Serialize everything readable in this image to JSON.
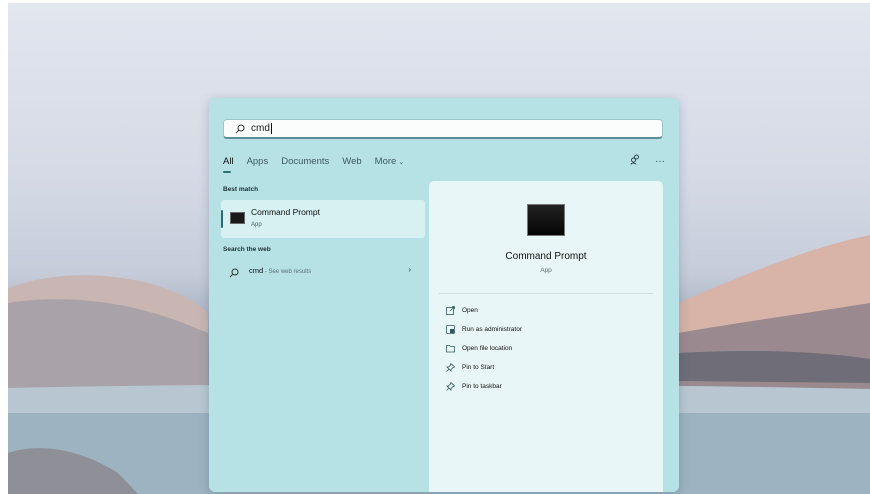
{
  "search": {
    "query": "cmd"
  },
  "tabs": [
    {
      "label": "All"
    },
    {
      "label": "Apps"
    },
    {
      "label": "Documents"
    },
    {
      "label": "Web"
    },
    {
      "label": "More"
    }
  ],
  "header_icons": [
    "people-switch-icon",
    "more-options-icon"
  ],
  "best_match": {
    "section_label": "Best match",
    "title": "Command Prompt",
    "subtitle": "App"
  },
  "web": {
    "section_label": "Search the web",
    "query": "cmd",
    "suffix": " - See web results"
  },
  "detail": {
    "title": "Command Prompt",
    "subtitle": "App",
    "actions": [
      {
        "label": "Open",
        "icon": "open-icon"
      },
      {
        "label": "Run as administrator",
        "icon": "shield-admin-icon"
      },
      {
        "label": "Open file location",
        "icon": "folder-icon"
      },
      {
        "label": "Pin to Start",
        "icon": "pin-icon"
      },
      {
        "label": "Pin to taskbar",
        "icon": "pin-icon"
      }
    ]
  },
  "colors": {
    "panel": "#b6e2e6",
    "detail": "#e9f6f7",
    "accent": "#266d78"
  }
}
